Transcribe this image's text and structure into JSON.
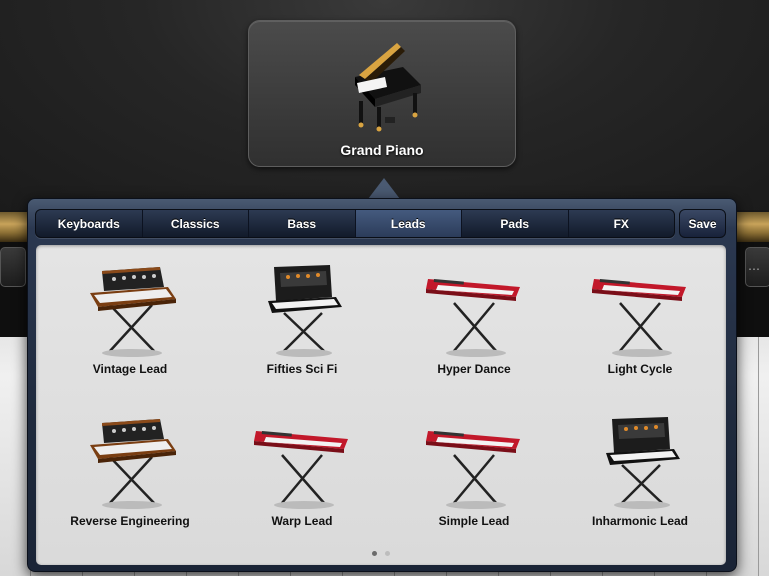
{
  "current_instrument": {
    "name": "Grand Piano",
    "icon": "grand-piano-icon"
  },
  "tabs": [
    {
      "label": "Keyboards",
      "active": false
    },
    {
      "label": "Classics",
      "active": false
    },
    {
      "label": "Bass",
      "active": false
    },
    {
      "label": "Leads",
      "active": true
    },
    {
      "label": "Pads",
      "active": false
    },
    {
      "label": "FX",
      "active": false
    }
  ],
  "save_label": "Save",
  "instruments": [
    {
      "label": "Vintage Lead",
      "icon": "vintage-synth-icon"
    },
    {
      "label": "Fifties Sci Fi",
      "icon": "black-synth-icon"
    },
    {
      "label": "Hyper Dance",
      "icon": "red-synth-icon"
    },
    {
      "label": "Light Cycle",
      "icon": "red-synth-icon"
    },
    {
      "label": "Reverse Engineering",
      "icon": "vintage-synth-icon"
    },
    {
      "label": "Warp Lead",
      "icon": "red-synth-icon"
    },
    {
      "label": "Simple Lead",
      "icon": "red-synth-icon"
    },
    {
      "label": "Inharmonic Lead",
      "icon": "black-synth-icon"
    }
  ],
  "pagination": {
    "pages": 2,
    "current": 1
  },
  "colors": {
    "popover": "#1f2a3d",
    "tab_active": "#3a4d6e",
    "grid_bg": "#e0e0e0"
  }
}
